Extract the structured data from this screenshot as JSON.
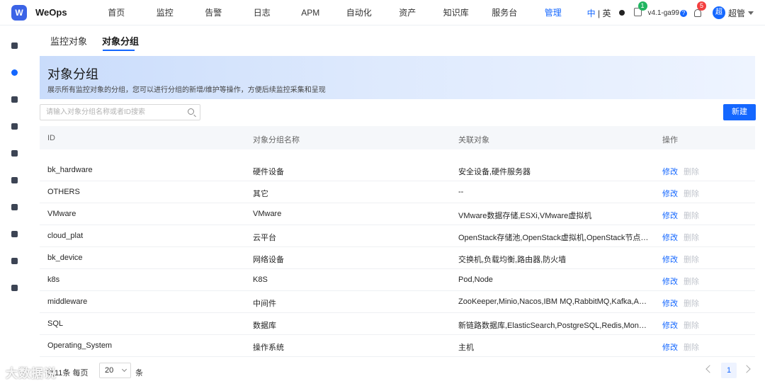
{
  "app": {
    "name": "WeOps",
    "logo_glyph": "W"
  },
  "nav": {
    "items": [
      "首页",
      "监控",
      "告警",
      "日志",
      "APM",
      "自动化",
      "资产",
      "知识库",
      "服务台",
      "管理"
    ],
    "active_index": 9
  },
  "header": {
    "lang_zh": "中",
    "lang_sep": " | ",
    "lang_en": "英",
    "notice_count": "1",
    "version": "v4.1-ga99",
    "version_help": "?",
    "alarm_count": "5",
    "avatar_text": "超",
    "username": "超管"
  },
  "sidebar": {
    "icons": [
      "dashboard-icon",
      "monitor-icon",
      "chart-icon",
      "report-icon",
      "compass-icon",
      "briefcase-icon",
      "layers-icon",
      "book-icon",
      "clipboard-icon",
      "settings-icon"
    ],
    "active_index": 1
  },
  "tabs": [
    "监控对象",
    "对象分组"
  ],
  "active_tab": 1,
  "hero": {
    "title": "对象分组",
    "desc": "展示所有监控对象的分组，您可以进行分组的新增/维护等操作，方便后续监控采集和呈现"
  },
  "search": {
    "placeholder": "请输入对象分组名称或者ID搜索",
    "value": ""
  },
  "new_button": "新建",
  "table": {
    "columns": [
      "ID",
      "对象分组名称",
      "关联对象",
      "操作"
    ],
    "edit_label": "修改",
    "delete_label": "删除",
    "rows": [
      [
        "bk_hardware",
        "硬件设备",
        "安全设备,硬件服务器"
      ],
      [
        "OTHERS",
        "其它",
        "--"
      ],
      [
        "VMware",
        "VMware",
        "VMware数据存储,ESXi,VMware虚拟机"
      ],
      [
        "cloud_plat",
        "云平台",
        "OpenStack存储池,OpenStack虚拟机,OpenStack节点,CV..."
      ],
      [
        "bk_device",
        "网络设备",
        "交换机,负载均衡,路由器,防火墙"
      ],
      [
        "k8s",
        "K8S",
        "Pod,Node"
      ],
      [
        "middleware",
        "中间件",
        "ZooKeeper,Minio,Nacos,IBM MQ,RabbitMQ,Kafka,Apac..."
      ],
      [
        "SQL",
        "数据库",
        "新链路数据库,ElasticSearch,PostgreSQL,Redis,MongoDB,..."
      ],
      [
        "Operating_System",
        "操作系统",
        "主机"
      ]
    ]
  },
  "pager": {
    "total_label": "共11条  每页",
    "page_size": "20",
    "unit": "条",
    "current_page": "1"
  },
  "watermark": "大数据说"
}
